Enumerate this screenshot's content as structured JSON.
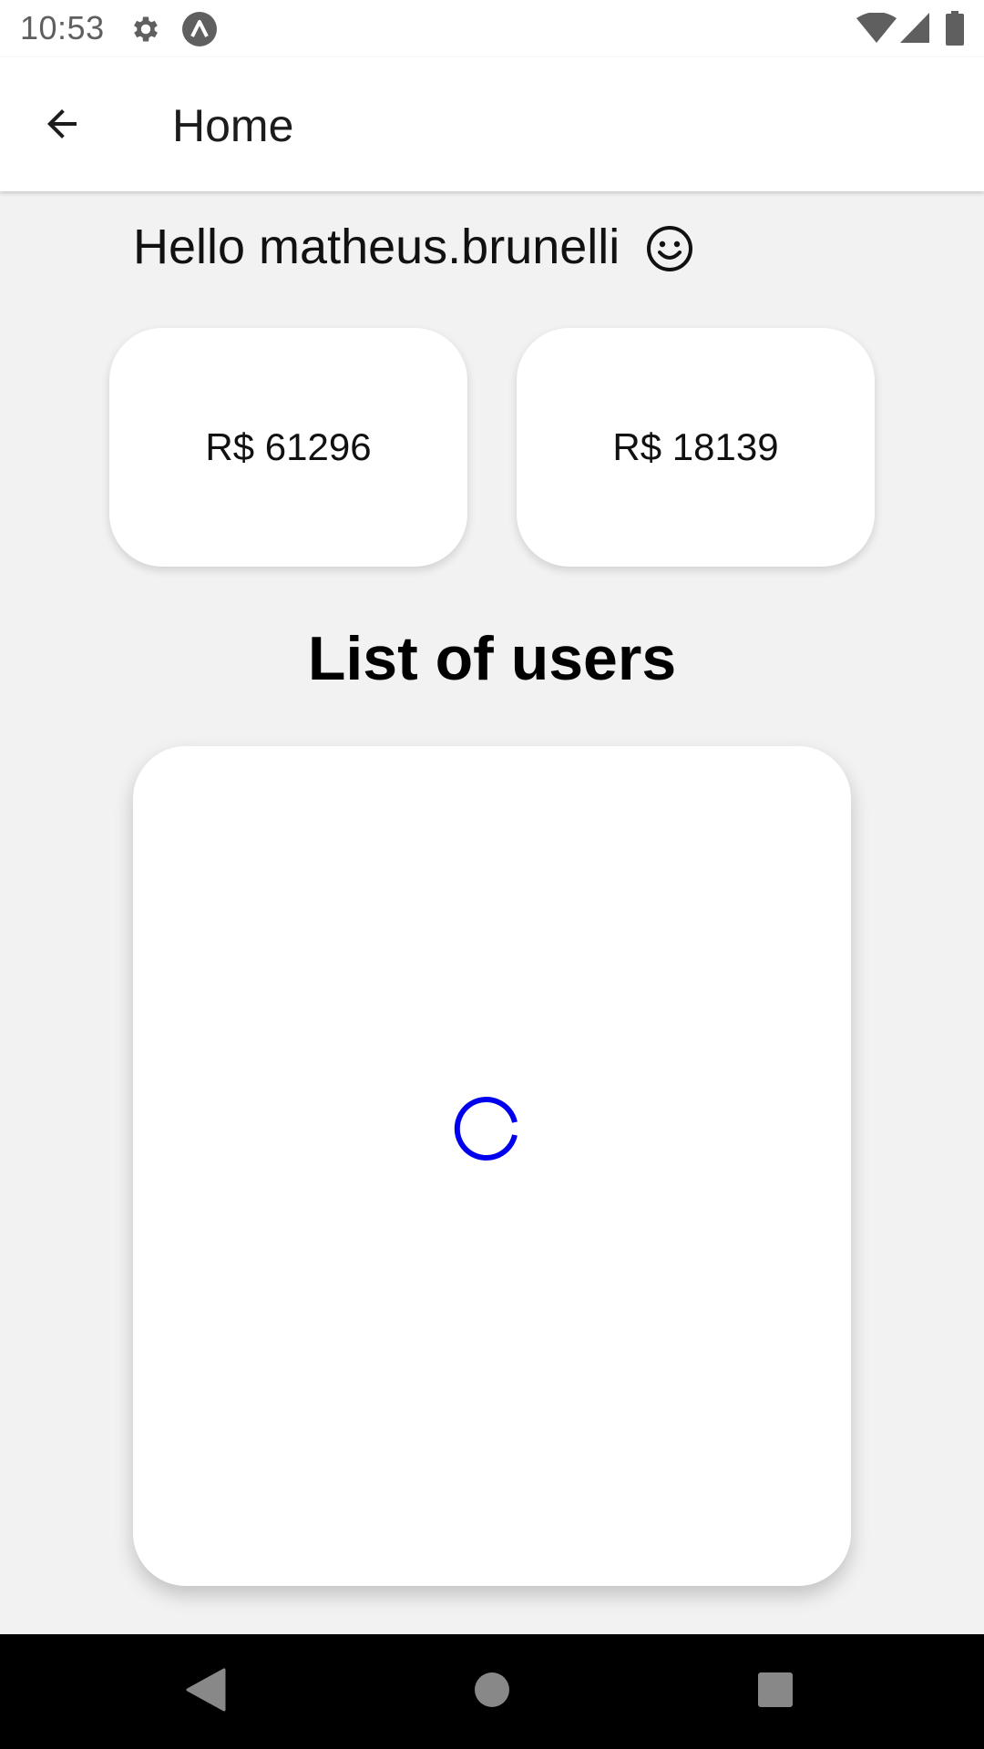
{
  "status_bar": {
    "time": "10:53",
    "left_icons": [
      "gear-icon",
      "app-logo-icon"
    ],
    "right_icons": [
      "wifi-icon",
      "signal-icon",
      "battery-icon"
    ]
  },
  "app_bar": {
    "back_icon": "arrow-back-icon",
    "title": "Home"
  },
  "greeting": {
    "text": "Hello matheus.brunelli",
    "emoji_icon": "smiley-icon"
  },
  "cards": [
    {
      "value": "R$ 61296"
    },
    {
      "value": "R$ 18139"
    }
  ],
  "users_section": {
    "title": "List of users",
    "loading": true
  },
  "nav_bar": {
    "buttons": [
      "nav-back-icon",
      "nav-home-icon",
      "nav-recents-icon"
    ]
  },
  "colors": {
    "spinner": "#0000ee",
    "background": "#f2f2f2",
    "surface": "#ffffff"
  }
}
